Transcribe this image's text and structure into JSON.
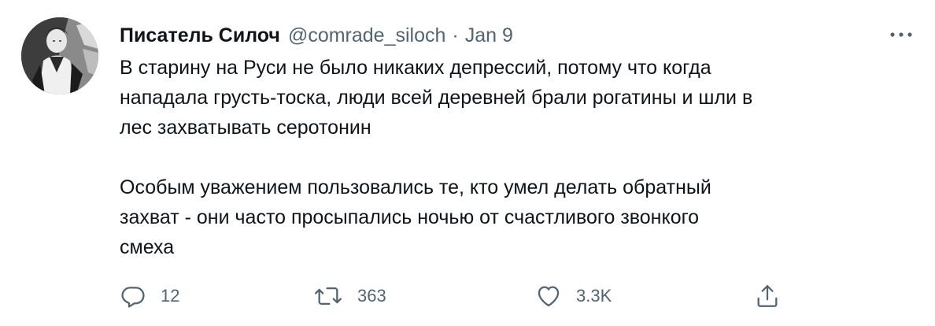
{
  "author": {
    "display_name": "Писатель Силоч",
    "handle": "@comrade_siloch",
    "separator": "·",
    "date": "Jan 9"
  },
  "tweet": {
    "paragraph_1": "В старину на Руси не было никаких депрессий, потому что когда\nнападала грусть-тоска, люди всей деревней брали рогатины и шли в\nлес захватывать серотонин",
    "paragraph_2": "Особым уважением пользовались те, кто умел делать обратный\nзахват - они часто просыпались ночью от счастливого звонкого\nсмеха"
  },
  "actions": {
    "reply_count": "12",
    "retweet_count": "363",
    "like_count": "3.3K"
  },
  "icons": {
    "more": "more-horizontal-icon",
    "reply": "reply-icon",
    "retweet": "retweet-icon",
    "like": "heart-icon",
    "share": "share-icon"
  },
  "colors": {
    "text": "#0f1419",
    "secondary": "#536471",
    "background": "#ffffff"
  }
}
